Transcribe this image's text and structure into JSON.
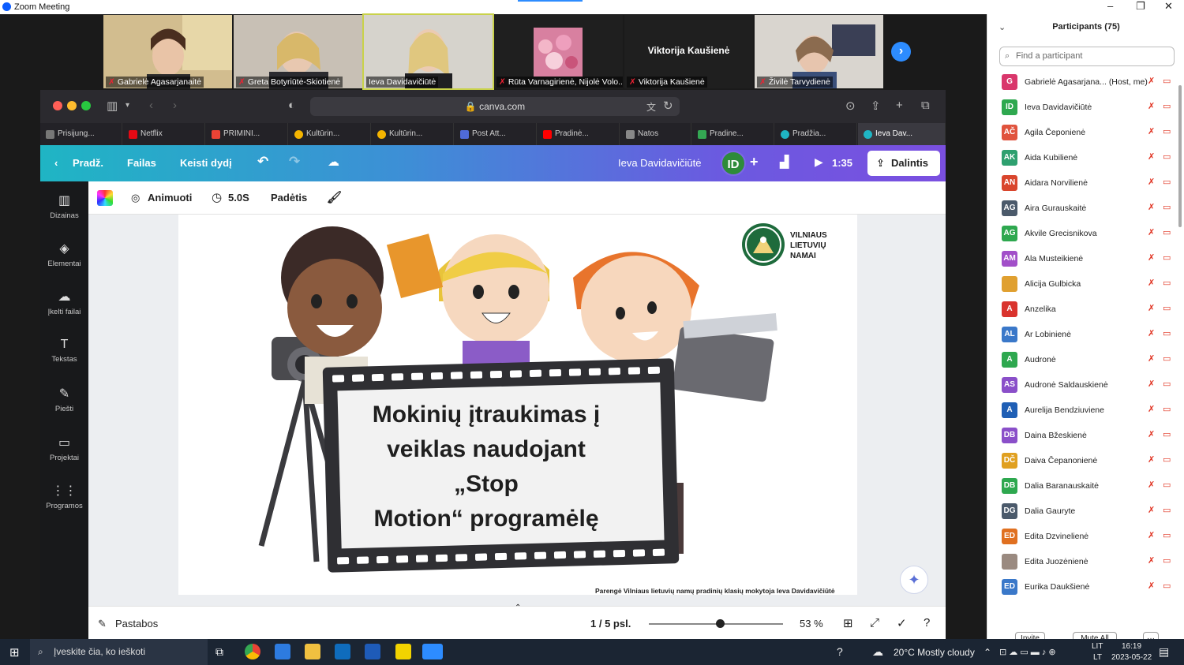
{
  "window": {
    "title": "Zoom Meeting"
  },
  "gallery": [
    {
      "name": "Gabrielė Agasarjanaitė",
      "muted": true
    },
    {
      "name": "Greta Botyriūtė-Skiotienė",
      "muted": true
    },
    {
      "name": "Ieva Davidavičiūtė",
      "muted": false,
      "speaking": true
    },
    {
      "name": "Rūta Varnagirienė, Nijolė Volo...",
      "muted": true
    },
    {
      "name": "Viktorija Kaušienė",
      "muted": true,
      "no_video": true
    },
    {
      "name": "Živilė Tarvydienė",
      "muted": true
    }
  ],
  "browser": {
    "url": "canva.com",
    "tabs": [
      "Prisijung...",
      "Netflix",
      "PRIMINI...",
      "Kultūrin...",
      "Kultūrin...",
      "Post Att...",
      "Pradinė...",
      "Natos",
      "Pradine...",
      "Pradžia...",
      "Ieva Dav..."
    ]
  },
  "canva": {
    "back_label": "Pradž.",
    "file_label": "Failas",
    "resize_label": "Keisti dydį",
    "user_name": "Ieva Davidavičiūtė",
    "avatar_initials": "ID",
    "timer": "1:35",
    "share_label": "Dalintis",
    "sidebar": [
      "Dizainas",
      "Elementai",
      "Įkelti failai",
      "Tekstas",
      "Piešti",
      "Projektai",
      "Programos"
    ],
    "toolbar": {
      "animate": "Animuoti",
      "duration": "5.0S",
      "position": "Padėtis"
    },
    "slide": {
      "logo_lines": [
        "VILNIAUS",
        "LIETUVIŲ",
        "NAMAI"
      ],
      "title_lines": [
        "Mokinių įtraukimas į",
        "veiklas naudojant",
        "„Stop",
        "Motion“ programėlę"
      ],
      "credit": "Parengė Vilniaus lietuvių namų pradinių klasių mokytoja Ieva Davidavičiūtė"
    },
    "bottom": {
      "notes": "Pastabos",
      "pages": "1 / 5 psl.",
      "zoom": "53 %",
      "zoom_level": 0.53
    }
  },
  "participants": {
    "title": "Participants (75)",
    "search_placeholder": "Find a participant",
    "list": [
      {
        "initials": "G",
        "name": "Gabrielė Agasarjana... (Host, me)",
        "color": "#d9366b"
      },
      {
        "initials": "ID",
        "name": "Ieva Davidavičiūtė",
        "color": "#2ea84f"
      },
      {
        "initials": "AČ",
        "name": "Agila Čeponienė",
        "color": "#e0533d"
      },
      {
        "initials": "AK",
        "name": "Aida Kubilienė",
        "color": "#2ea06f"
      },
      {
        "initials": "AN",
        "name": "Aidara Norvilienė",
        "color": "#d9462d"
      },
      {
        "initials": "AG",
        "name": "Aira Gurauskaitė",
        "color": "#4b5a6b"
      },
      {
        "initials": "AG",
        "name": "Akvile Grecisnikova",
        "color": "#2ea84f"
      },
      {
        "initials": "AM",
        "name": "Ala Musteikienė",
        "color": "#a24fc9"
      },
      {
        "initials": "",
        "name": "Alicija Gulbicka",
        "color": "#e0a030"
      },
      {
        "initials": "A",
        "name": "Anzelika",
        "color": "#d9332d"
      },
      {
        "initials": "AL",
        "name": "Ar Lobinienė",
        "color": "#3a78c9"
      },
      {
        "initials": "A",
        "name": "Audronė",
        "color": "#2ea84f"
      },
      {
        "initials": "AS",
        "name": "Audronė Saldauskienė",
        "color": "#8a4fc9"
      },
      {
        "initials": "A",
        "name": "Aurelija Bendziuviene",
        "color": "#1f5fb5"
      },
      {
        "initials": "DB",
        "name": "Daina Bžeskienė",
        "color": "#8a4fc9"
      },
      {
        "initials": "DČ",
        "name": "Daiva Čepanonienė",
        "color": "#e0a020"
      },
      {
        "initials": "DB",
        "name": "Dalia Baranauskaitė",
        "color": "#2ea84f"
      },
      {
        "initials": "DG",
        "name": "Dalia Gauryte",
        "color": "#4b5a6b"
      },
      {
        "initials": "ED",
        "name": "Edita Dzvinelienė",
        "color": "#e07020"
      },
      {
        "initials": "",
        "name": "Edita Juozėnienė",
        "color": "#9a8a80"
      },
      {
        "initials": "ED",
        "name": "Eurika Daukšienė",
        "color": "#3a78c9"
      }
    ],
    "invite_label": "Invite",
    "mute_all_label": "Mute All",
    "more_label": "···"
  },
  "taskbar": {
    "search_placeholder": "Įveskite čia, ko ieškoti",
    "weather": "20°C  Mostly cloudy",
    "lang_top": "LIT",
    "lang_bottom": "LT",
    "time": "16:19",
    "date": "2023-05-22"
  }
}
